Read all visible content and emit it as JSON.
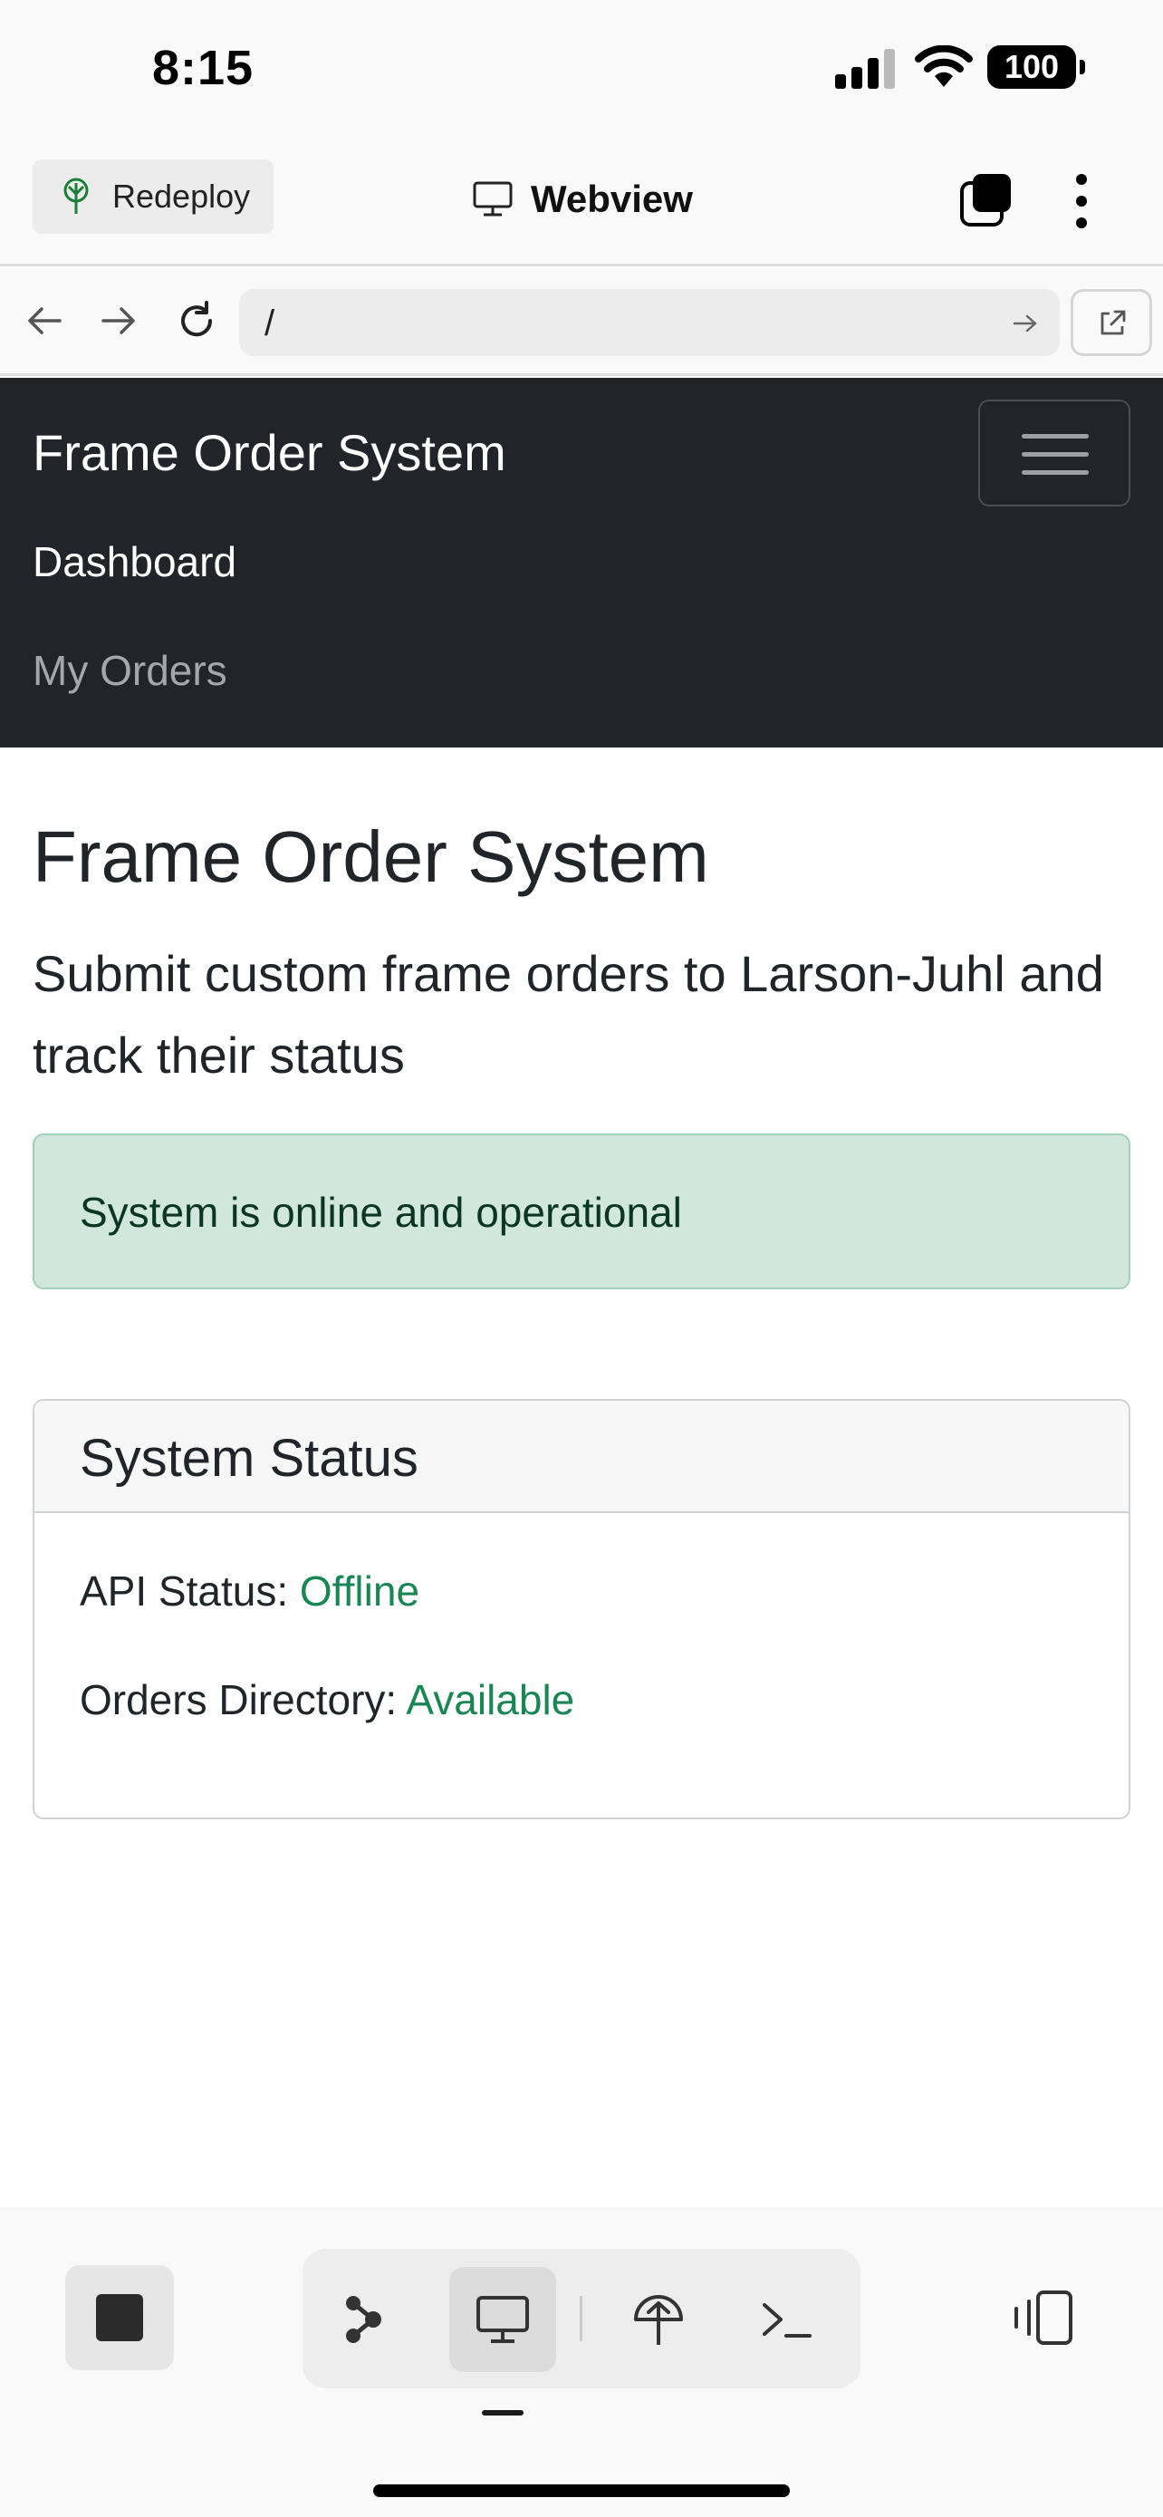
{
  "status_bar": {
    "time": "8:15",
    "battery": "100"
  },
  "app_header": {
    "redeploy_label": "Redeploy",
    "title": "Webview"
  },
  "url_bar": {
    "path": "/"
  },
  "site_nav": {
    "brand": "Frame Order System",
    "links": [
      {
        "label": "Dashboard",
        "active": true
      },
      {
        "label": "My Orders",
        "active": false
      }
    ]
  },
  "main": {
    "heading": "Frame Order System",
    "lead": "Submit custom frame orders to Larson-Juhl and track their status",
    "alert": "System is online and operational",
    "status_card": {
      "title": "System Status",
      "rows": [
        {
          "label": "API Status:",
          "value": "Offline"
        },
        {
          "label": "Orders Directory:",
          "value": "Available"
        }
      ]
    }
  },
  "colors": {
    "navbar_bg": "#212529",
    "alert_bg": "#d1e7dd",
    "alert_text": "#0a3622",
    "status_value": "#198754",
    "redeploy_icon": "#1a7f37"
  },
  "icons": {
    "redeploy": "deploy-tree-icon",
    "title": "monitor-icon",
    "tabs": "tabs-icon",
    "menu": "kebab-icon",
    "back": "arrow-left-icon",
    "forward": "arrow-right-icon",
    "reload": "reload-icon",
    "go": "arrow-right-icon",
    "open_external": "external-link-icon",
    "toolbar": [
      "stop-icon",
      "git-graph-icon",
      "monitor-icon",
      "deploy-icon",
      "terminal-icon",
      "panel-toggle-icon"
    ]
  }
}
